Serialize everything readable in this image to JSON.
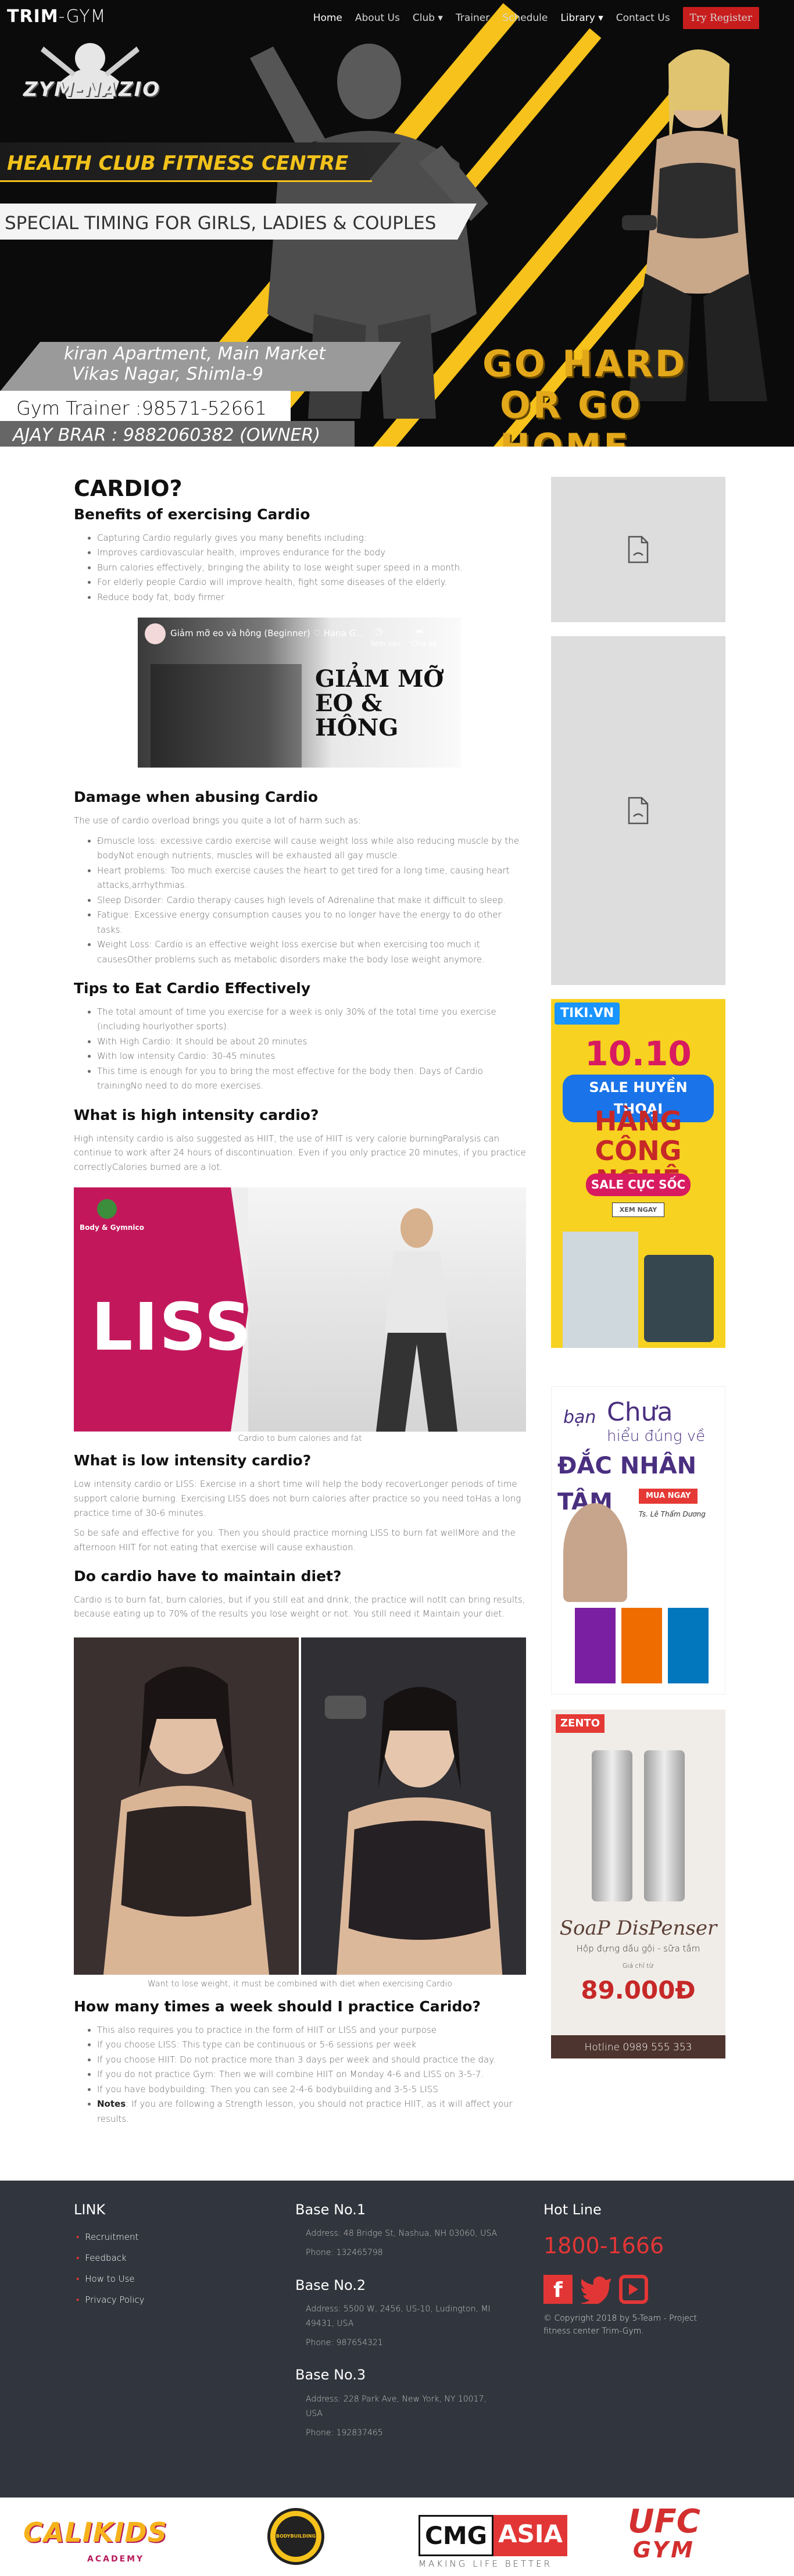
{
  "nav": {
    "brand_bold": "TRIM",
    "brand_light": "-GYM",
    "links": [
      "Home",
      "About Us",
      "Club ▾",
      "Trainer",
      "Schedule",
      "Library ▾",
      "Contact Us"
    ],
    "cta": "Try Register"
  },
  "hero": {
    "logo_text": "ZYM-NAZIO",
    "club": "HEALTH CLUB FITNESS CENTRE",
    "timing": "SPECIAL TIMING FOR GIRLS, LADIES & COUPLES",
    "address_line1": "kiran Apartment, Main Market",
    "address_line2": "Vikas Nagar, Shimla-9",
    "trainer": "Gym Trainer :98571-52661",
    "owner": "AJAY BRAR : 9882060382 (OWNER)",
    "slogan_1": "GO HARD",
    "slogan_2": "OR GO HOME."
  },
  "article": {
    "title": "CARDIO?",
    "s1_heading": "Benefits of exercising Cardio",
    "s1_items": [
      "Capturing Cardio regularly gives you many benefits including:",
      "Improves cardiovascular health, improves endurance for the body",
      "Burn calories effectively, bringing the ability to lose weight super speed in a month.",
      "For elderly people Cardio will improve health, fight some diseases of the elderly.",
      "Reduce body fat, body firmer"
    ],
    "video_title": "Giảm mỡ eo và hông (Beginner) ♡ Hana G...",
    "video_watch_later": "Xem sau",
    "video_share": "Chia sẻ",
    "video_overlay": "GIẢM MỠ EO & HÔNG",
    "s2_heading": "Damage when abusing Cardio",
    "s2_intro": "The use of cardio overload brings you quite a lot of harm such as:",
    "s2_items": [
      "Ðmuscle loss: excessive cardio exercise will cause weight loss while also reducing muscle by the bodyNot enough nutrients, muscles will be exhausted all gay muscle.",
      "Heart problems: Too much exercise causes the heart to get tired for a long time, causing heart attacks,arrhythmias.",
      "Sleep Disorder: Cardio therapy causes high levels of Adrenaline that make it difficult to sleep.",
      "Fatigue: Excessive energy consumption causes you to no longer have the energy to do other tasks.",
      "Weight Loss: Cardio is an effective weight loss exercise but when exercising too much it causesOther problems such as metabolic disorders make the body lose weight anymore."
    ],
    "s3_heading": "Tips to Eat Cardio Effectively",
    "s3_items": [
      "The total amount of time you exercise for a week is only 30% of the total time you exercise (including hourlyother sports).",
      "With High Cardio: It should be about 20 minutes",
      "With low intensity Cardio: 30-45 minutes",
      "This time is enough for you to bring the most effective for the body then. Days of Cardio trainingNo need to do more exercises."
    ],
    "s4_heading": "What is high intensity cardio?",
    "s4_text": "High intensity cardio is also suggested as HIIT, the use of HIIT is very calorie burningParalysis can continue to work after 24 hours of discontinuation. Even if you only practice 20 minutes, if you practice correctlyCalories burned are a lot.",
    "liss_badge": "Body & Gymnico",
    "liss_word": "LISS",
    "liss_caption": "Cardio to burn calories and fat",
    "s5_heading": "What is low intensity cardio?",
    "s5_text1": "Low intensity cardio or LISS: Exercise in a short time will help the body recoverLonger periods of time support calorie burning. Exercising LISS does not burn calories after practice so you need toHas a long practice time of 30-6 minutes.",
    "s5_text2": "So be safe and effective for you. Then you should practice morning LISS to burn fat wellMore and the afternoon HIIT for not eating that exercise will cause exhaustion.",
    "s6_heading": "Do cardio have to maintain diet?",
    "s6_text": "Cardio is to burn fat, burn calories, but if you still eat and drink, the practice will notIt can bring results, because eating up to 70% of the results you lose weight or not. You still need it Maintain your diet.",
    "diet_caption": "Want to lose weight, it must be combined with diet when exercising Cardio",
    "s7_heading": "How many times a week should I practice Carido?",
    "s7_items": [
      "This also requires you to practice in the form of HIIT or LISS and your purpose",
      "If you choose LISS: This type can be continuous or 5-6 sessions per week",
      "If you choose HIIT: Do not practice more than 3 days per week and should practice the day.",
      "If you do not practice Gym: Then we will combine HIIT on Monday 4-6 and LISS on 3-5-7.",
      "If you have bodybuilding: Then you can see 2-4-6 bodybuilding and 3-5-5 LISS"
    ],
    "s7_note_label": "Notes",
    "s7_note": ": If you are following a Strength lesson, you should not practice HIIT, as it will affect your results."
  },
  "ads": {
    "tiki_logo": "TIKI.VN",
    "tiki_date": "10.10",
    "tiki_sale": "SALE HUYỀN THOẠI",
    "tiki_line1": "HÀNG",
    "tiki_line2": "CÔNG NGHỆ",
    "tiki_hot": "SALE CỰC SỐC",
    "tiki_btn": "XEM NGAY",
    "book_1": "bạn",
    "book_2": "Chưa",
    "book_3": "hiểu đúng về",
    "book_4": "ĐẮC NHÂN TÂM",
    "book_btn": "MUA NGAY",
    "book_author": "Ts. Lê Thẩm Dương",
    "zento": "ZENTO",
    "soap": "SoaP DisPenser",
    "soap_sub": "Hộp đựng dầu gội - sữa tắm",
    "soap_price_label": "Giá chỉ từ",
    "soap_price": "89.000Đ",
    "soap_hotline": "Hotline 0989 555 353"
  },
  "footer": {
    "link_title": "LINK",
    "links": [
      "Recruitment",
      "Feedback",
      "How to Use",
      "Privacy Policy"
    ],
    "base1_title": "Base No.1",
    "base1_addr": "Address: 48 Bridge St, Nashua, NH 03060, USA",
    "base1_phone": "Phone: 132465798",
    "base2_title": "Base No.2",
    "base2_addr": "Address: 5500 W, 2456, US-10, Ludington, MI 49431, USA",
    "base2_phone": "Phone: 987654321",
    "base3_title": "Base No.3",
    "base3_addr": "Address: 228 Park Ave, New York, NY 10017, USA",
    "base3_phone": "Phone: 192837465",
    "hotline_title": "Hot Line",
    "hotline": "1800-1666",
    "copyright": "© Copyright 2018 by 5-Team - Project fitness center Trim-Gym."
  },
  "partners": {
    "p1": "CALIKIDS",
    "p1_sub": "ACADEMY",
    "p2": "BODYBUILDING",
    "p3_a": "CMG",
    "p3_b": "ASIA",
    "p3_sub": "MAKING LIFE BETTER",
    "p4_a": "UFC",
    "p4_b": "GYM"
  },
  "colors": {
    "accent": "#f6c21b",
    "red": "#e23636",
    "footer": "#31353d"
  }
}
